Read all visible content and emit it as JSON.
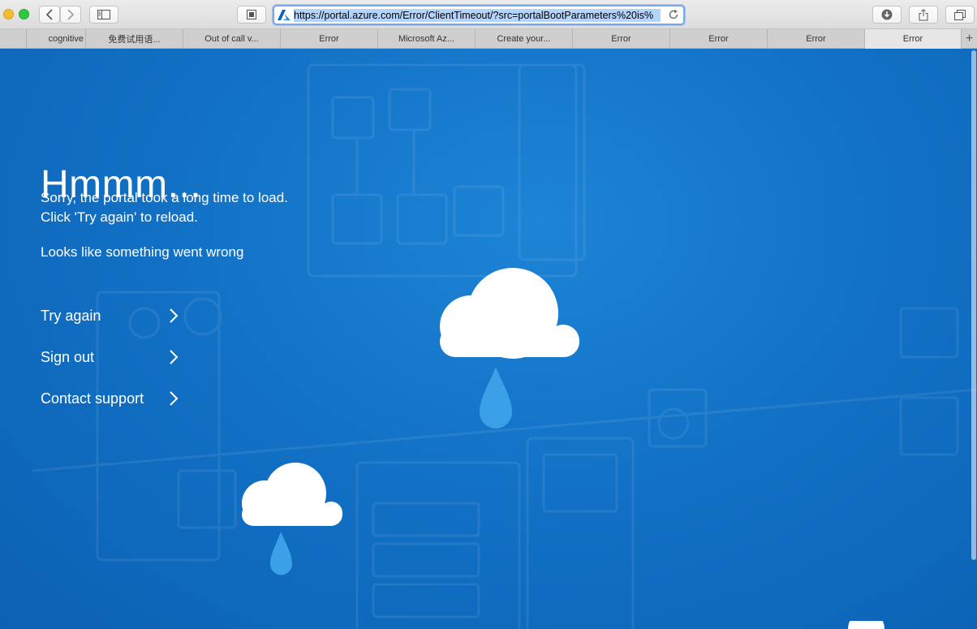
{
  "browser": {
    "url": "https://portal.azure.com/Error/ClientTimeout/?src=portalBootParameters%20is%",
    "tabs": [
      {
        "label": "cognitive"
      },
      {
        "label": "免费试用语..."
      },
      {
        "label": "Out of call v..."
      },
      {
        "label": "Error"
      },
      {
        "label": "Microsoft Az..."
      },
      {
        "label": "Create your..."
      },
      {
        "label": "Error"
      },
      {
        "label": "Error"
      },
      {
        "label": "Error"
      },
      {
        "label": "Error"
      }
    ],
    "active_tab_index": 9,
    "new_tab_glyph": "+"
  },
  "page": {
    "title": "Hmmm...",
    "message": "Sorry, the portal took a long time to load. Click 'Try again' to reload.",
    "message2": "Looks like something went wrong",
    "actions": [
      {
        "label": "Try again"
      },
      {
        "label": "Sign out"
      },
      {
        "label": "Contact support"
      }
    ]
  },
  "colors": {
    "background": "#1272c6",
    "cloud": "#ffffff",
    "drop": "#3aa0e8"
  }
}
